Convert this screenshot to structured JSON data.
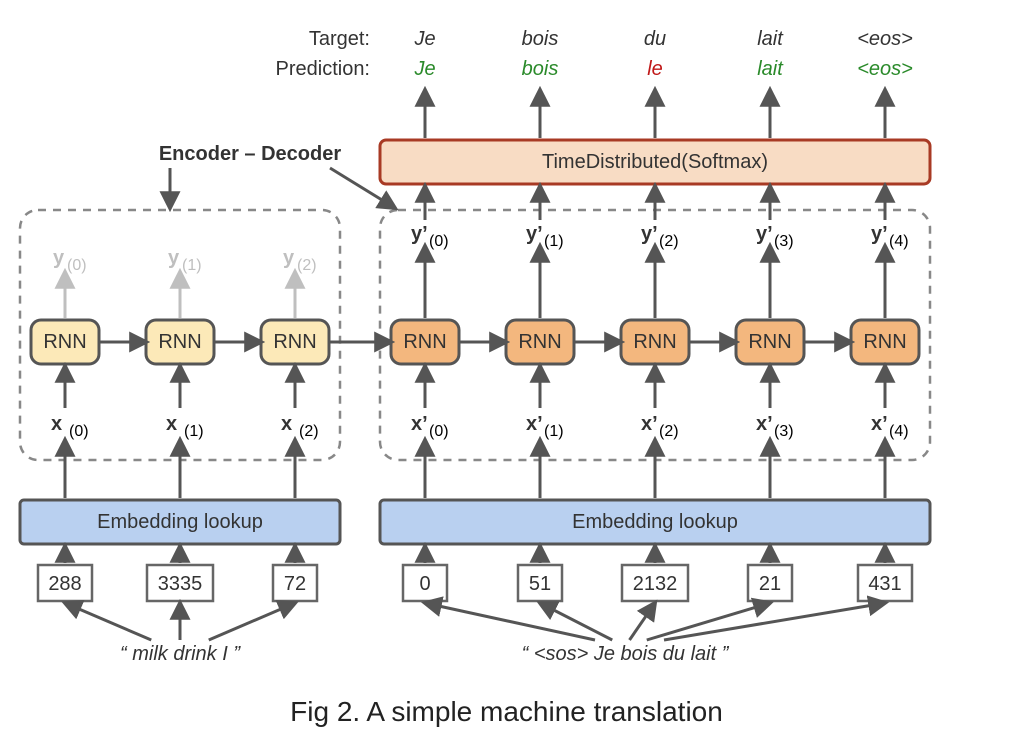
{
  "title": "Encoder – Decoder",
  "caption": "Fig 2. A simple machine translation",
  "softmax_label": "TimeDistributed(Softmax)",
  "target_label": "Target:",
  "prediction_label": "Prediction:",
  "embedding_label": "Embedding lookup",
  "rnn_label": "RNN",
  "encoder": {
    "count": 3,
    "x_labels": [
      "x",
      "x",
      "x"
    ],
    "x_subs": [
      "(0)",
      "(1)",
      "(2)"
    ],
    "y_labels": [
      "y",
      "y",
      "y"
    ],
    "y_subs": [
      "(0)",
      "(1)",
      "(2)"
    ],
    "token_ids": [
      "288",
      "3335",
      "72"
    ],
    "input_phrase": "“ milk drink I ”"
  },
  "decoder": {
    "count": 5,
    "x_labels": [
      "x’",
      "x’",
      "x’",
      "x’",
      "x’"
    ],
    "x_subs": [
      "(0)",
      "(1)",
      "(2)",
      "(3)",
      "(4)"
    ],
    "y_labels": [
      "y’",
      "y’",
      "y’",
      "y’",
      "y’"
    ],
    "y_subs": [
      "(0)",
      "(1)",
      "(2)",
      "(3)",
      "(4)"
    ],
    "token_ids": [
      "0",
      "51",
      "2132",
      "21",
      "431"
    ],
    "input_phrase": "“ <sos>  Je bois du lait ”",
    "targets": [
      "Je",
      "bois",
      "du",
      "lait",
      "<eos>"
    ],
    "predictions": [
      "Je",
      "bois",
      "le",
      "lait",
      "<eos>"
    ],
    "pred_correct": [
      true,
      true,
      false,
      true,
      true
    ]
  }
}
